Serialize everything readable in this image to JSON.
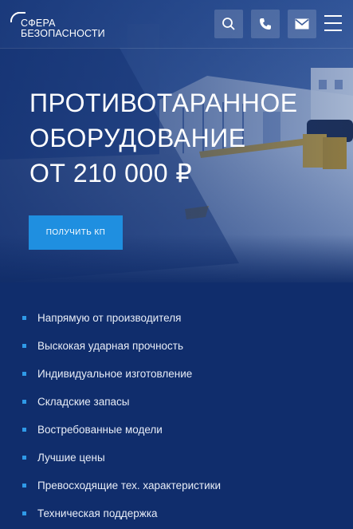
{
  "header": {
    "logo_line1": "СФЕРА",
    "logo_line2": "БЕЗОПАСНОСТИ",
    "icons": [
      "search-icon",
      "phone-icon",
      "mail-icon",
      "menu-icon"
    ]
  },
  "hero": {
    "title_lines": [
      "ПРОТИВОТАРАННОЕ",
      "ОБОРУДОВАНИЕ",
      "ОТ 210 000 ₽"
    ],
    "cta_label": "ПОЛУЧИТЬ КП"
  },
  "features": [
    "Напрямую от производителя",
    "Выскокая ударная прочность",
    "Индивидуальное изготовление",
    "Складские запасы",
    "Востребованные модели",
    "Лучшие цены",
    "Превосходящие тех. характеристики",
    "Техническая поддержка"
  ],
  "colors": {
    "background": "#102d6c",
    "accent": "#1f8fe0",
    "bullet": "#2f9ae8"
  }
}
